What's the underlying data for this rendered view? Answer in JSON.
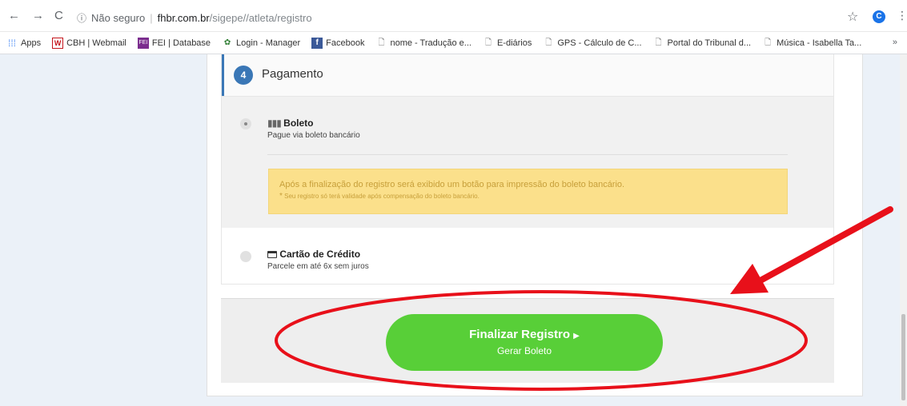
{
  "browser": {
    "info_icon": "info-icon",
    "not_secure": "Não seguro",
    "url_host": "fhbr.com.br",
    "url_path": "/sigepe//atleta/registro",
    "profile_initial": "C"
  },
  "bookmarks": [
    {
      "label": "Apps",
      "icon": "apps-grid-icon"
    },
    {
      "label": "CBH | Webmail",
      "icon": "webmail-icon"
    },
    {
      "label": "FEI | Database",
      "icon": "fei-icon"
    },
    {
      "label": "Login - Manager",
      "icon": "login-icon"
    },
    {
      "label": "Facebook",
      "icon": "facebook-icon"
    },
    {
      "label": "nome - Tradução e...",
      "icon": "page-icon"
    },
    {
      "label": "E-diários",
      "icon": "page-icon"
    },
    {
      "label": "GPS - Cálculo de C...",
      "icon": "page-icon"
    },
    {
      "label": "Portal do Tribunal d...",
      "icon": "page-icon"
    },
    {
      "label": "Música - Isabella Ta...",
      "icon": "page-icon"
    }
  ],
  "bookmarks_more": "»",
  "step": {
    "number": "4",
    "title": "Pagamento"
  },
  "options": {
    "boleto": {
      "icon": "barcode-icon",
      "title": "Boleto",
      "subtitle": "Pague via boleto bancário",
      "selected": true
    },
    "notice": {
      "main": "Após a finalização do registro será exibido um botão para impressão do boleto bancário.",
      "asterisk": "*",
      "footnote": "Seu registro só terá validade após compensação do boleto bancário."
    },
    "card": {
      "icon": "credit-card-icon",
      "title": "Cartão de Crédito",
      "subtitle": "Parcele em até 6x sem juros",
      "selected": false
    }
  },
  "finish_button": {
    "line1": "Finalizar Registro",
    "line2": "Gerar Boleto"
  },
  "colors": {
    "accent": "#3a77b6",
    "button": "#58cf38",
    "notice_bg": "#fbe08b",
    "annotation": "#e8101a"
  }
}
